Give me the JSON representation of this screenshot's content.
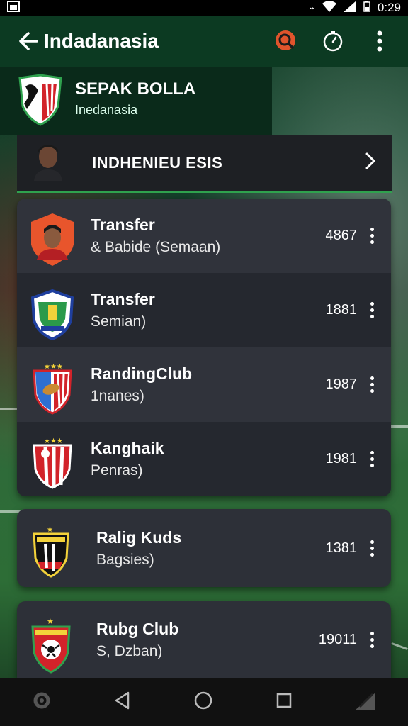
{
  "status_bar": {
    "time": "0:29"
  },
  "app_bar": {
    "title": "Indadanasia"
  },
  "league": {
    "title": "SEPAK BOLLA",
    "subtitle": "Inedanasia"
  },
  "team_row": {
    "name": "INDHENIEU ESIS"
  },
  "list_items": [
    {
      "title": "Transfer",
      "subtitle": "& Babide (Semaan)",
      "value": "4867"
    },
    {
      "title": "Transfer",
      "subtitle": "Semian)",
      "value": "1881"
    },
    {
      "title": "RandingClub",
      "subtitle": "1nanes)",
      "value": "1987"
    },
    {
      "title": "Kanghaik",
      "subtitle": "Penras)",
      "value": "1981"
    }
  ],
  "cards": [
    {
      "title": "Ralig Kuds",
      "subtitle": "Bagsies)",
      "value": "1381"
    },
    {
      "title": "Rubg Club",
      "subtitle": "S, Dzban)",
      "value": "19011"
    }
  ],
  "colors": {
    "app_bar": "#0c3a22",
    "accent_green": "#2fa24e",
    "panel": "#2d3038",
    "search_badge": "#e0542c"
  },
  "icons": [
    "back-arrow-icon",
    "search-icon",
    "timer-icon",
    "more-vert-icon",
    "chevron-right-icon",
    "back-nav-icon",
    "home-nav-icon",
    "recents-nav-icon"
  ]
}
